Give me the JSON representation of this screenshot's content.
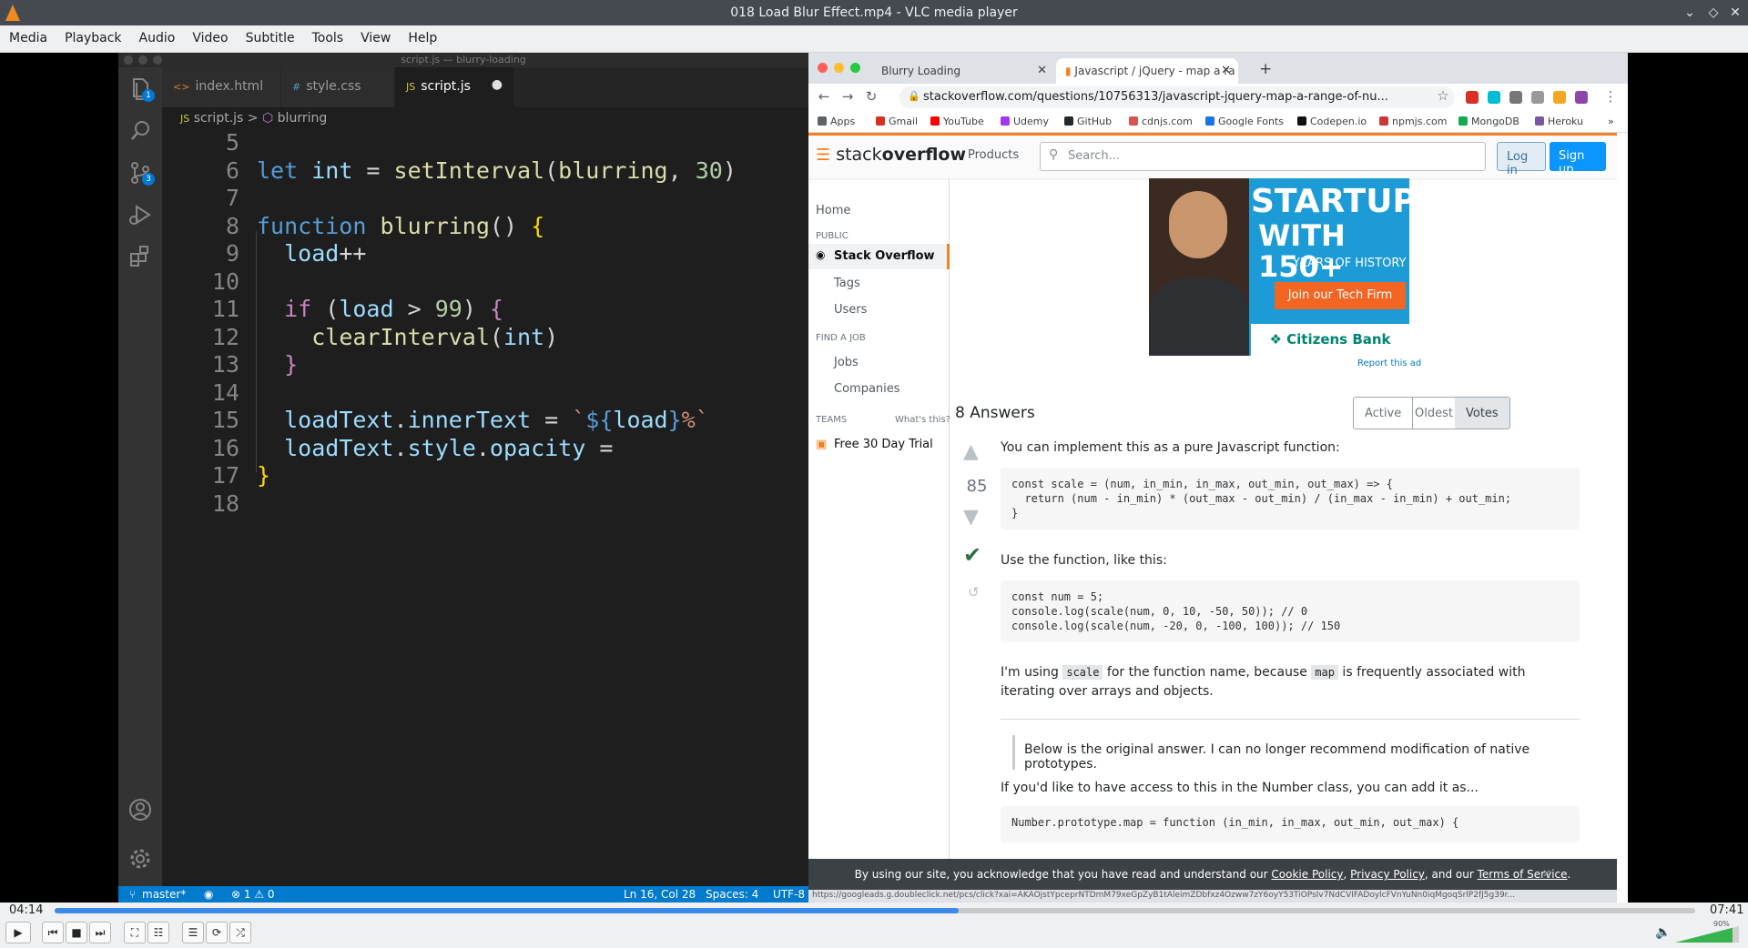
{
  "window": {
    "title": "018 Load Blur Effect.mp4 - VLC media player"
  },
  "menu": [
    "Media",
    "Playback",
    "Audio",
    "Video",
    "Subtitle",
    "Tools",
    "View",
    "Help"
  ],
  "vscode": {
    "window_title": "script.js — blurry-loading",
    "tabs": [
      {
        "label": "index.html",
        "icon": "<>"
      },
      {
        "label": "style.css",
        "icon": "#"
      },
      {
        "label": "script.js",
        "icon": "JS",
        "modified": true
      }
    ],
    "breadcrumb": {
      "file": "script.js",
      "symbol": "blurring",
      "separator": ">"
    },
    "badges": {
      "explorer": "1",
      "scm": "3"
    },
    "status": {
      "branch": "master*",
      "problems": "⊗ 1 ⚠ 0",
      "position": "Ln 16, Col 28",
      "spaces": "Spaces: 4",
      "encoding": "UTF-8"
    },
    "lines": [
      {
        "n": "5",
        "html": ""
      },
      {
        "n": "6",
        "html": "<span class='kw'>let</span> <span class='var'>int</span> = <span class='fn'>setInterval</span>(<span class='fn'>blurring</span>, <span class='num'>30</span>)"
      },
      {
        "n": "7",
        "html": ""
      },
      {
        "n": "8",
        "html": "<span class='kw'>function</span> <span class='fn'>blurring</span>() <span class='brk'>{</span>"
      },
      {
        "n": "9",
        "html": "  <span class='var'>load</span>++"
      },
      {
        "n": "10",
        "html": ""
      },
      {
        "n": "11",
        "html": "  <span class='ctl'>if</span> (<span class='var'>load</span> &gt; <span class='num'>99</span>) <span class='ctl'>{</span>"
      },
      {
        "n": "12",
        "html": "    <span class='fn'>clearInterval</span>(<span class='var'>int</span>)"
      },
      {
        "n": "13",
        "html": "  <span class='ctl'>}</span>"
      },
      {
        "n": "14",
        "html": ""
      },
      {
        "n": "15",
        "html": "  <span class='var'>loadText</span>.<span class='var'>innerText</span> = <span class='str'>`</span><span class='kw'>${</span><span class='var'>load</span><span class='kw'>}</span><span class='str'>%`</span>"
      },
      {
        "n": "16",
        "html": "  <span class='var'>loadText</span>.<span class='var'>style</span>.<span class='var'>opacity</span> ="
      },
      {
        "n": "17",
        "html": "<span class='brk'>}</span>"
      },
      {
        "n": "18",
        "html": ""
      }
    ]
  },
  "browser": {
    "tabs": [
      {
        "label": "Blurry Loading"
      },
      {
        "label": "Javascript / jQuery - map a ra"
      }
    ],
    "url": "stackoverflow.com/questions/10756313/javascript-jquery-map-a-range-of-nu...",
    "bookmarks": [
      {
        "label": "Apps",
        "color": "#5f6368"
      },
      {
        "label": "Gmail",
        "color": "#d93025"
      },
      {
        "label": "YouTube",
        "color": "#ff0000"
      },
      {
        "label": "Udemy",
        "color": "#a435f0"
      },
      {
        "label": "GitHub",
        "color": "#24292e"
      },
      {
        "label": "cdnjs.com",
        "color": "#d9534f"
      },
      {
        "label": "Google Fonts",
        "color": "#1a73e8"
      },
      {
        "label": "Codepen.io",
        "color": "#111111"
      },
      {
        "label": "npmjs.com",
        "color": "#cb3837"
      },
      {
        "label": "MongoDB",
        "color": "#13aa52"
      },
      {
        "label": "Heroku",
        "color": "#79589f"
      }
    ],
    "status_link": "https://googleads.g.doubleclick.net/pcs/click?xai=AKAOjstYpceprNTDmM79xeGpZyB1tAleimZDbfxz4Ozww7zY6oyY53TiOPslv7NdCVIFADoylcFVnYuNn0iqMgoqSrlP2fJ5g39r..."
  },
  "so": {
    "logo_a": "stack",
    "logo_b": "overflow",
    "products": "Products",
    "search_placeholder": "Search...",
    "login": "Log in",
    "signup": "Sign up",
    "nav": {
      "home": "Home",
      "public": "PUBLIC",
      "stackoverflow": "Stack Overflow",
      "tags": "Tags",
      "users": "Users",
      "find_job": "FIND A JOB",
      "jobs": "Jobs",
      "companies": "Companies",
      "teams": "TEAMS",
      "whats_this": "What's this?",
      "trial": "Free 30 Day Trial"
    },
    "ad": {
      "line1": "STARTUP",
      "line2": "WITH 150+",
      "line3": "YEARS OF HISTORY",
      "cta": "Join our Tech Firm",
      "brand": "Citizens Bank",
      "report": "Report this ad"
    },
    "answers": {
      "count": "8 Answers",
      "sort": [
        "Active",
        "Oldest",
        "Votes"
      ],
      "votes": "85",
      "p1": "You can implement this as a pure Javascript function:",
      "code1": "const scale = (num, in_min, in_max, out_min, out_max) => {\n  return (num - in_min) * (out_max - out_min) / (in_max - in_min) + out_min;\n}",
      "p2": "Use the function, like this:",
      "code2": "const num = 5;\nconsole.log(scale(num, 0, 10, -50, 50)); // 0\nconsole.log(scale(num, -20, 0, -100, 100)); // 150",
      "p3a": "I'm using ",
      "p3b": "scale",
      "p3c": " for the function name, because ",
      "p3d": "map",
      "p3e": " is frequently associated with iterating over arrays and objects.",
      "quote": "Below is the original answer. I can no longer recommend modification of native prototypes.",
      "p4": "If you'd like to have access to this in the Number class, you can add it as...",
      "code3": "Number.prototype.map = function (in_min, in_max, out_min, out_max) {"
    },
    "cookie": {
      "text": "By using our site, you acknowledge that you have read and understand our ",
      "cookie_policy": "Cookie Policy",
      "privacy": "Privacy Policy",
      "and": ", and our ",
      "terms": "Terms of Service"
    }
  },
  "player": {
    "elapsed": "04:14",
    "total": "07:41",
    "progress_fraction": 0.551,
    "volume_percent": "90%"
  }
}
